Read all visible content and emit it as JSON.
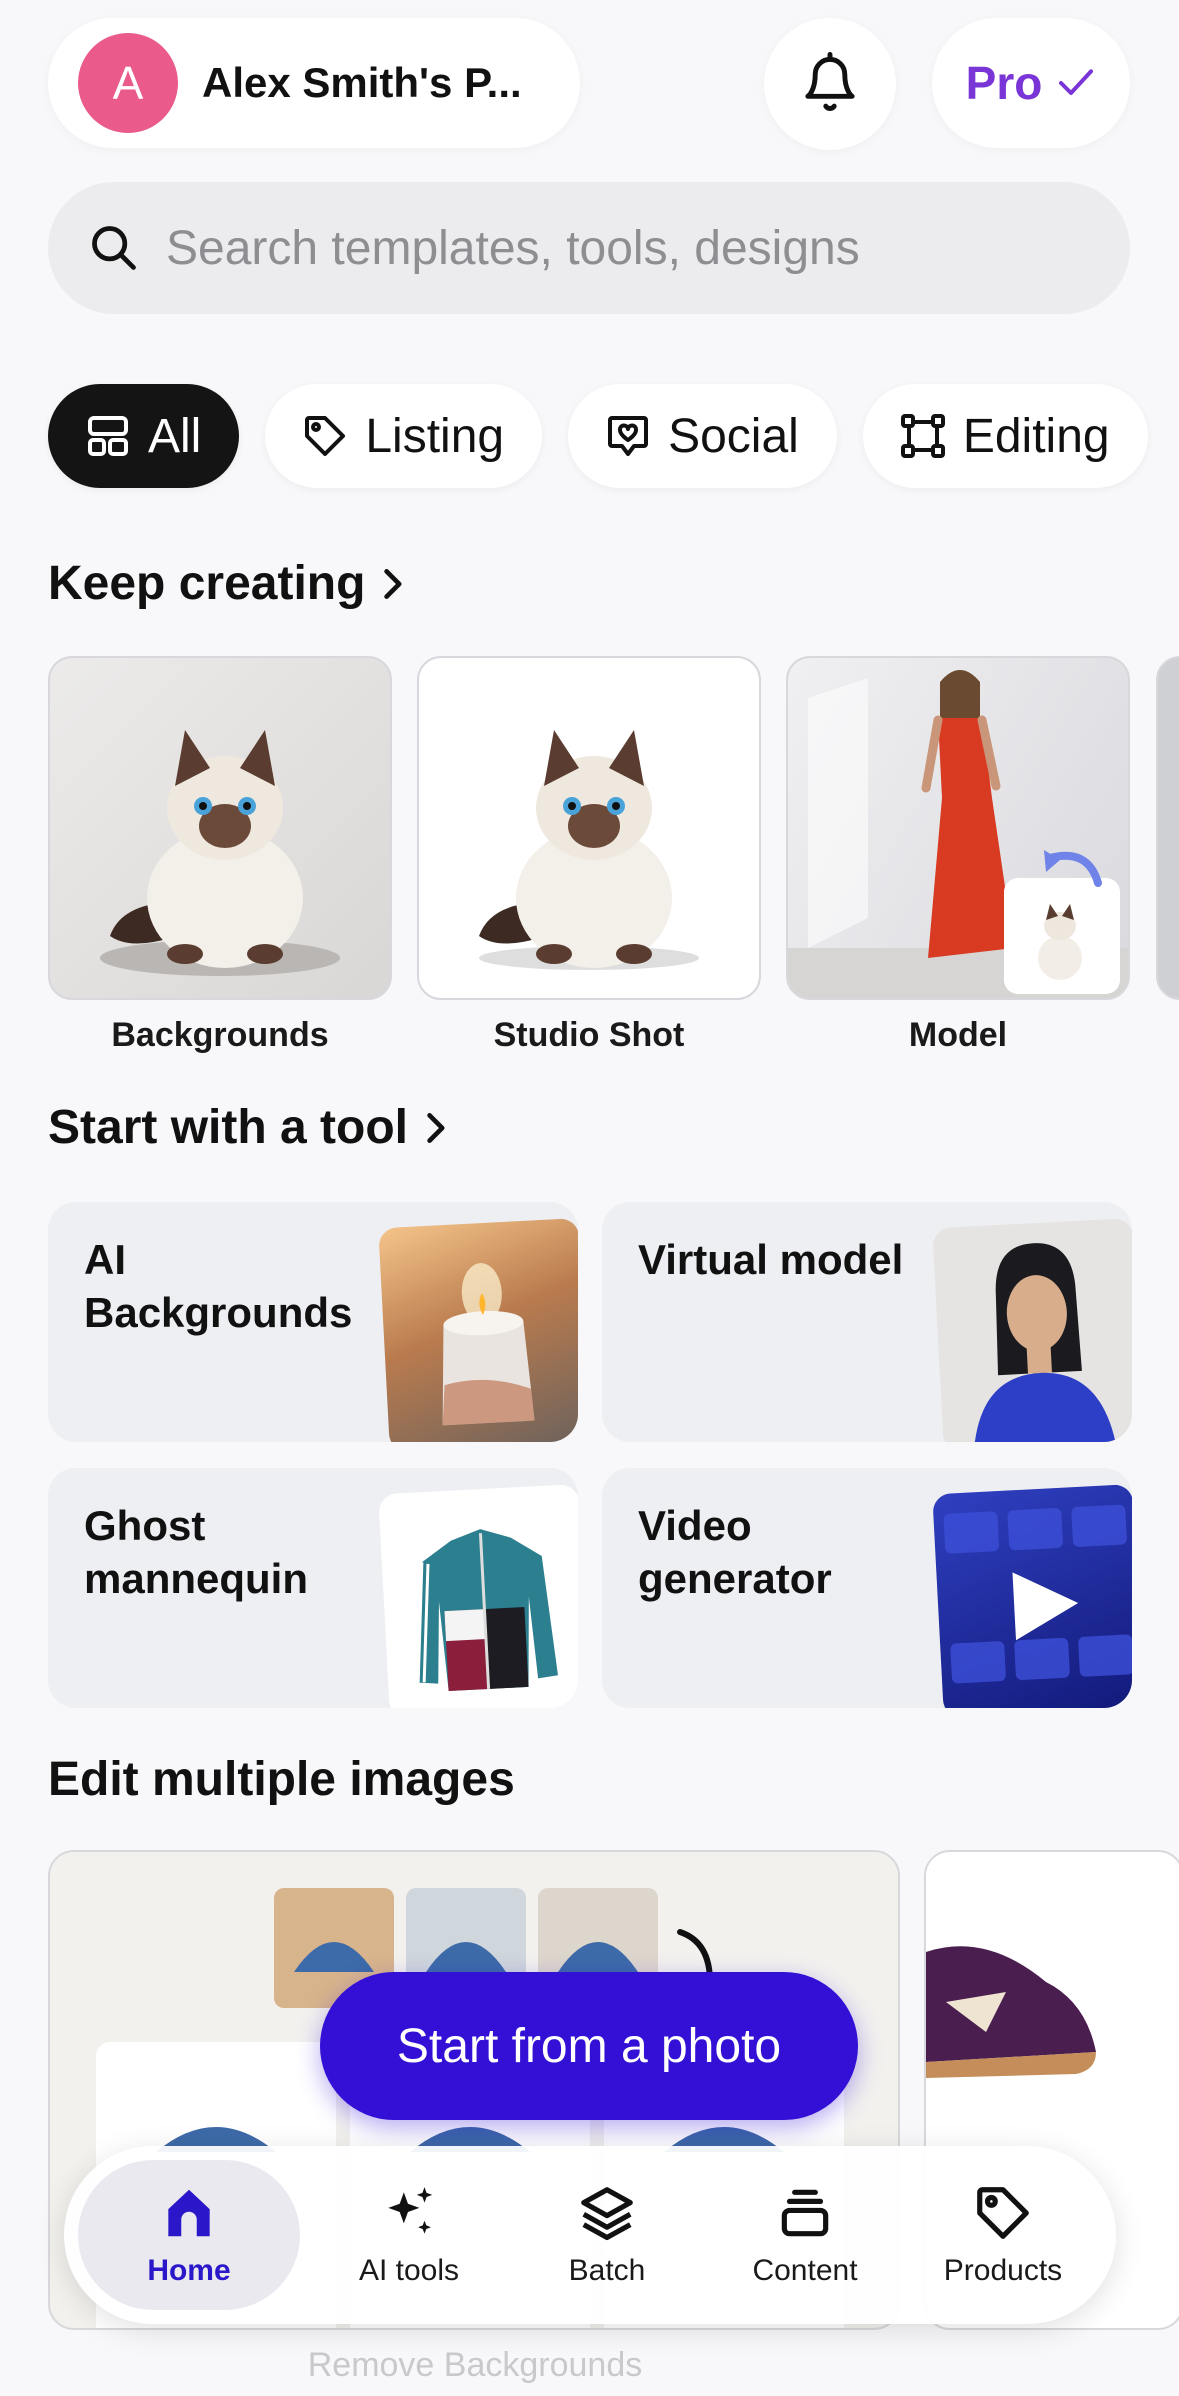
{
  "header": {
    "avatar_initial": "A",
    "account_name": "Alex Smith's P...",
    "pro_label": "Pro"
  },
  "search": {
    "placeholder": "Search templates, tools, designs"
  },
  "filters": [
    {
      "label": "All",
      "icon": "grid-icon",
      "active": true
    },
    {
      "label": "Listing",
      "icon": "tag-icon",
      "active": false
    },
    {
      "label": "Social",
      "icon": "heart-chat-icon",
      "active": false
    },
    {
      "label": "Editing",
      "icon": "crop-frame-icon",
      "active": false
    }
  ],
  "keep_creating": {
    "title": "Keep creating",
    "items": [
      {
        "label": "Backgrounds"
      },
      {
        "label": "Studio Shot"
      },
      {
        "label": "Model"
      }
    ]
  },
  "tools": {
    "title": "Start with a tool",
    "items": [
      {
        "label": "AI Backgrounds"
      },
      {
        "label": "Virtual model"
      },
      {
        "label": "Ghost mannequin"
      },
      {
        "label": "Video generator"
      }
    ]
  },
  "edit_multiple": {
    "title": "Edit multiple images",
    "card_label": "Remove Backgrounds"
  },
  "cta": {
    "label": "Start from a photo"
  },
  "tabbar": [
    {
      "label": "Home",
      "icon": "home-icon",
      "active": true
    },
    {
      "label": "AI tools",
      "icon": "sparkles-icon",
      "active": false
    },
    {
      "label": "Batch",
      "icon": "layers-icon",
      "active": false
    },
    {
      "label": "Content",
      "icon": "stack-icon",
      "active": false
    },
    {
      "label": "Products",
      "icon": "tag-icon",
      "active": false
    }
  ],
  "colors": {
    "accent": "#3410d6",
    "pro": "#7a35d6",
    "avatar": "#ea5a8a",
    "chip_active": "#141414"
  }
}
